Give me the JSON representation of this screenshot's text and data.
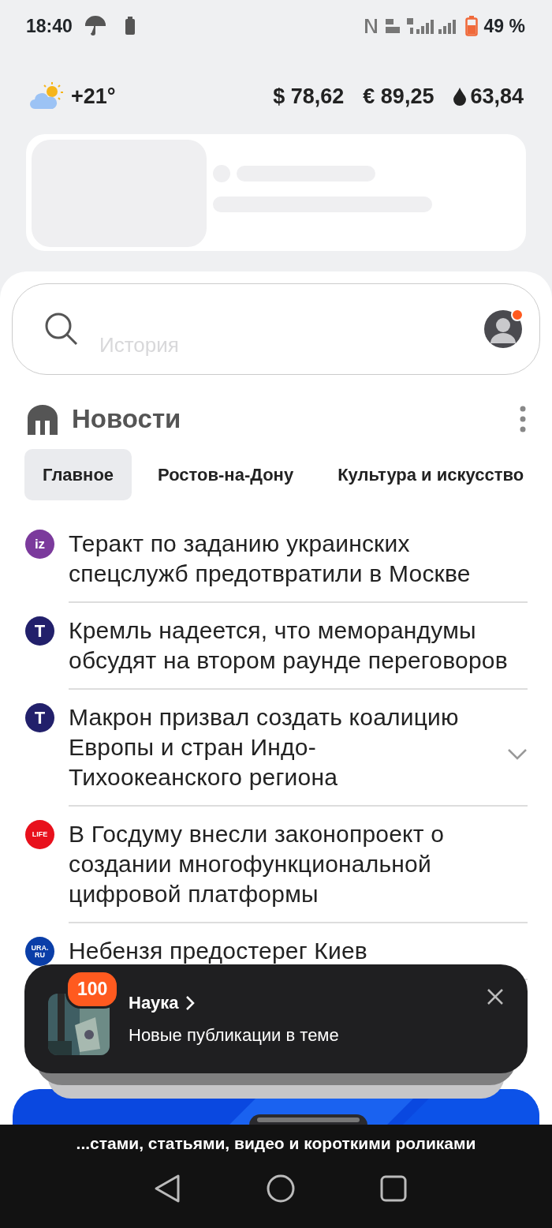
{
  "status_bar": {
    "time": "18:40",
    "battery_text": "49 %"
  },
  "widgets": {
    "temperature": "+21°",
    "rates": [
      {
        "kind": "currency",
        "text": "$ 78,62"
      },
      {
        "kind": "currency",
        "text": "€ 89,25"
      },
      {
        "kind": "oil",
        "text": "63,84"
      }
    ]
  },
  "search": {
    "placeholder": "История",
    "notification": true
  },
  "news": {
    "title": "Новости",
    "tabs": [
      {
        "label": "Главное",
        "selected": true
      },
      {
        "label": "Ростов-на-Дону",
        "selected": false
      },
      {
        "label": "Культура и искусство",
        "selected": false
      }
    ],
    "items": [
      {
        "logo": "iz",
        "color": "#7b3a9c",
        "text": "Теракт по заданию украинских спецслужб предотвратили в Москве",
        "expandable": false
      },
      {
        "logo": "T",
        "color": "#22206b",
        "text": "Кремль надеется, что меморандумы обсудят на втором раунде переговоров",
        "expandable": false
      },
      {
        "logo": "T",
        "color": "#22206b",
        "text": "Макрон призвал создать коалицию Европы и стран Индо-Тихоокеанского региона",
        "expandable": true
      },
      {
        "logo": "LIFE",
        "color": "#e8101c",
        "text": "В Госдуму внесли законопроект о создании многофункциональной цифровой платформы",
        "expandable": false
      },
      {
        "logo": "URA. RU",
        "color": "#0a3ea8",
        "text": "Небензя предостерег Киев",
        "expandable": false
      }
    ]
  },
  "toast": {
    "badge": "100",
    "title": "Наука",
    "subtitle": "Новые публикации в теме"
  },
  "caption": "...стами, статьями, видео и короткими роликами"
}
